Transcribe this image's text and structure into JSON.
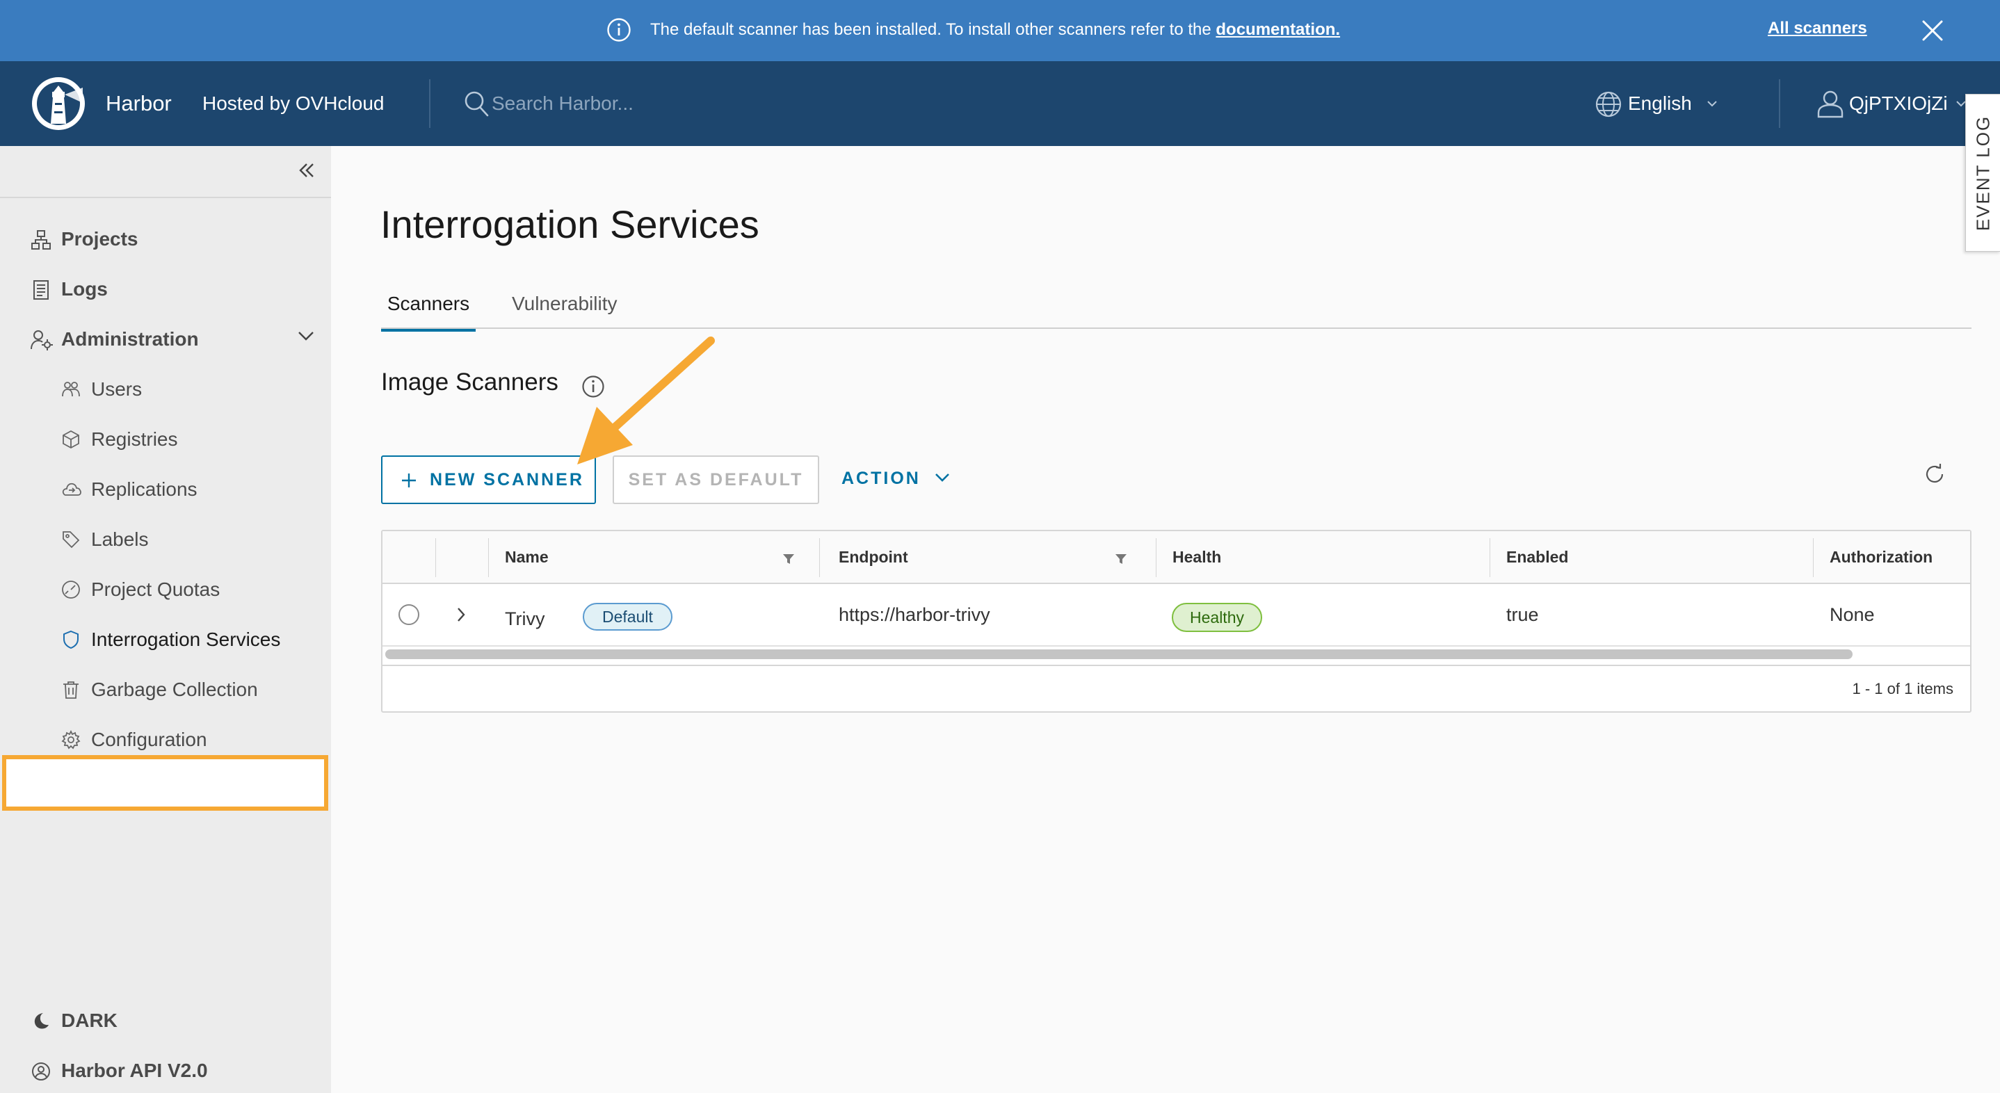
{
  "banner": {
    "message": "The default scanner has been installed. To install other scanners refer to the",
    "link": "documentation.",
    "all_scanners": "All scanners"
  },
  "header": {
    "brand": "Harbor",
    "hosted": "Hosted by OVHcloud",
    "search_placeholder": "Search Harbor...",
    "language": "English",
    "user": "QjPTXIOjZi"
  },
  "event_log": "EVENT LOG",
  "sidebar": {
    "items": [
      {
        "label": "Projects",
        "icon": "projects-icon"
      },
      {
        "label": "Logs",
        "icon": "logs-icon"
      },
      {
        "label": "Administration",
        "icon": "administration-icon"
      }
    ],
    "admin_items": [
      {
        "label": "Users",
        "icon": "users-icon"
      },
      {
        "label": "Registries",
        "icon": "registries-icon"
      },
      {
        "label": "Replications",
        "icon": "replications-icon"
      },
      {
        "label": "Labels",
        "icon": "labels-icon"
      },
      {
        "label": "Project Quotas",
        "icon": "project-quotas-icon"
      },
      {
        "label": "Interrogation Services",
        "icon": "shield-icon"
      },
      {
        "label": "Garbage Collection",
        "icon": "trash-icon"
      },
      {
        "label": "Configuration",
        "icon": "gear-icon"
      }
    ],
    "active": "Interrogation Services",
    "dark_label": "DARK",
    "api_label": "Harbor API V2.0"
  },
  "main": {
    "title": "Interrogation Services",
    "tabs": [
      {
        "label": "Scanners",
        "active": true
      },
      {
        "label": "Vulnerability",
        "active": false
      }
    ],
    "section_title": "Image Scanners",
    "buttons": {
      "new_scanner": "NEW SCANNER",
      "set_default": "SET AS DEFAULT",
      "action": "ACTION"
    },
    "table": {
      "columns": [
        "Name",
        "Endpoint",
        "Health",
        "Enabled",
        "Authorization"
      ],
      "rows": [
        {
          "name": "Trivy",
          "badge": "Default",
          "endpoint": "https://harbor-trivy",
          "health": "Healthy",
          "enabled": "true",
          "authorization": "None"
        }
      ],
      "pagination": "1 - 1 of 1 items"
    }
  },
  "colors": {
    "banner": "#3a7cbf",
    "header": "#1d466e",
    "primary": "#0072a3",
    "highlight": "#f6a833",
    "healthy": "#7fbf3f"
  }
}
